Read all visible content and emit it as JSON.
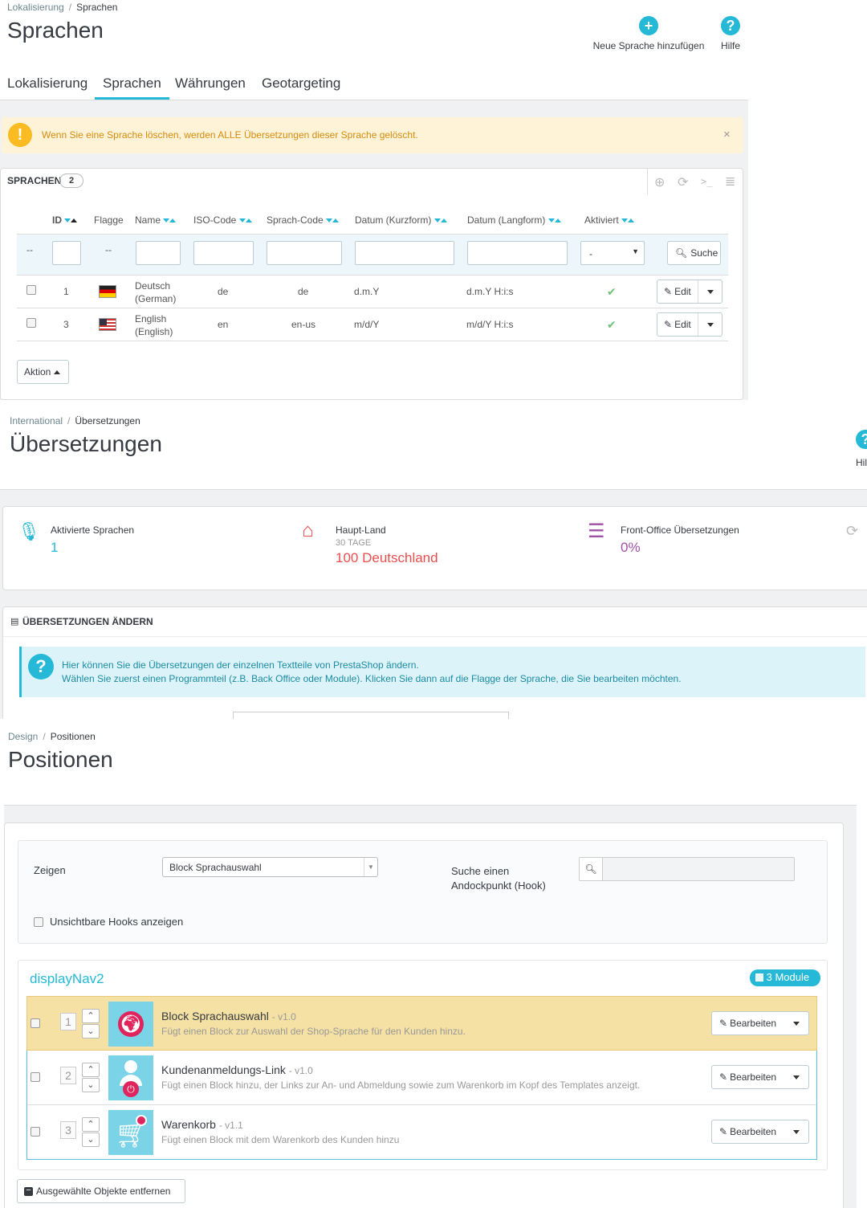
{
  "s1": {
    "breadcrumb": [
      "Lokalisierung",
      "Sprachen"
    ],
    "title": "Sprachen",
    "header_buttons": [
      {
        "label": "Neue Sprache hinzufügen",
        "icon": "plus-circle-icon"
      },
      {
        "label": "Hilfe",
        "icon": "question-circle-icon"
      }
    ],
    "tabs": [
      "Lokalisierung",
      "Sprachen",
      "Währungen",
      "Geotargeting"
    ],
    "active_tab": "Sprachen",
    "warning": "Wenn Sie eine Sprache löschen, werden ALLE Übersetzungen dieser Sprache gelöscht.",
    "panel_title": "SPRACHEN",
    "panel_count": "2",
    "columns": [
      "ID",
      "Flagge",
      "Name",
      "ISO-Code",
      "Sprach-Code",
      "Datum (Kurzform)",
      "Datum (Langform)",
      "Aktiviert"
    ],
    "filter_placeholder": "--",
    "filter_select": "-",
    "search_label": "Suche",
    "rows": [
      {
        "id": "1",
        "name1": "Deutsch",
        "name2": "(German)",
        "iso": "de",
        "code": "de",
        "short": "d.m.Y",
        "long": "d.m.Y H:i:s",
        "edit": "Edit"
      },
      {
        "id": "3",
        "name1": "English",
        "name2": "(English)",
        "iso": "en",
        "code": "en-us",
        "short": "m/d/Y",
        "long": "m/d/Y H:i:s",
        "edit": "Edit"
      }
    ],
    "bulk_label": "Aktion"
  },
  "s2": {
    "breadcrumb": [
      "International",
      "Übersetzungen"
    ],
    "title": "Übersetzungen",
    "help_label": "Hil",
    "stats": [
      {
        "title": "Aktivierte Sprachen",
        "sub": "",
        "value": "1",
        "icon": "microphone-icon",
        "color": "#25b9d7"
      },
      {
        "title": "Haupt-Land",
        "sub": "30 TAGE",
        "value": "100 Deutschland",
        "icon": "home-icon",
        "color": "#e84e4e"
      },
      {
        "title": "Front-Office Übersetzungen",
        "sub": "",
        "value": "0%",
        "icon": "list-icon",
        "color": "#a050a6"
      }
    ],
    "panel_title": "ÜBERSETZUNGEN ÄNDERN",
    "info_line1": "Hier können Sie die Übersetzungen der einzelnen Textteile von PrestaShop ändern.",
    "info_line2": "Wählen Sie zuerst einen Programmteil (z.B. Back Office oder Module). Klicken Sie dann auf die Flagge der Sprache, die Sie bearbeiten möchten."
  },
  "s3": {
    "breadcrumb": [
      "Design",
      "Positionen"
    ],
    "title": "Positionen",
    "show_label": "Zeigen",
    "show_value": "Block Sprachauswahl",
    "hook_search_label1": "Suche einen",
    "hook_search_label2": "Andockpunkt (Hook)",
    "invisible_hooks": "Unsichtbare Hooks anzeigen",
    "hook_name": "displayNav2",
    "module_count": "3 Module",
    "modules": [
      {
        "pos": "1",
        "name": "Block Sprachauswahl",
        "version": "- v1.0",
        "desc": "Fügt einen Block zur Auswahl der Shop-Sprache für den Kunden hinzu.",
        "edit": "Bearbeiten",
        "icon": "globe-icon"
      },
      {
        "pos": "2",
        "name": "Kundenanmeldungs-Link",
        "version": "- v1.0",
        "desc": "Fügt einen Block hinzu, der Links zur An- und Abmeldung sowie zum Warenkorb im Kopf des Templates anzeigt.",
        "edit": "Bearbeiten",
        "icon": "user-power-icon"
      },
      {
        "pos": "3",
        "name": "Warenkorb",
        "version": "- v1.1",
        "desc": "Fügt einen Block mit dem Warenkorb des Kunden hinzu",
        "edit": "Bearbeiten",
        "icon": "cart-icon"
      }
    ],
    "remove_label": "Ausgewählte Objekte entfernen"
  }
}
